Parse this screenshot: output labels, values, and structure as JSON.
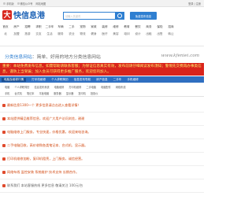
{
  "topbar": {
    "items": [
      "手机版",
      "微信公众号",
      "网站地图"
    ],
    "right": "登录 | 注册"
  },
  "logo": {
    "mark": "大",
    "name": "快信息港"
  },
  "search": {
    "placeholder": "请输入关键词"
  },
  "header": {
    "publish_label": "免费发布信息"
  },
  "nav": {
    "row1": [
      "首页",
      "房产",
      "招聘",
      "求职",
      "二手车",
      "车辆",
      "二手",
      "宠物",
      "家政",
      "装修",
      "维修",
      "教育",
      "餐饮",
      "商务",
      "保险",
      "招商"
    ],
    "row2": [
      "北",
      "加盟",
      "旅游",
      "交友",
      "生活",
      "服务",
      "农业",
      "物流",
      "健身",
      "医疗",
      "美容",
      "培训",
      "设计",
      "出租",
      "出售",
      "转让"
    ]
  },
  "slogan": {
    "prefix": "分类信息网站",
    "suffix": "：简单、好用的地方分类信息网站",
    "url": "www.kfeniei.com"
  },
  "notice": {
    "text": "重要：本站免费发布信息，如需帮助请联系客服；为保证信息真实有效，发布前请仔细阅读发布须知；警惕先交费再办事类信息，谨防上当受骗；加入会员可获得更多推广服务，欢迎您的加入。"
  },
  "tabs": [
    "电脑及维修行情",
    "打印机维修",
    "个人求职简历",
    "信息发布导航",
    "房产信息",
    "二手车",
    "手机维修"
  ],
  "subtabs": {
    "row1": [
      "电脑",
      "个人求职简历",
      "信息发布系统",
      "电脑维修",
      "打印机维修",
      "二手电脑",
      "电脑配件",
      "网络布线"
    ],
    "row2": [
      "手机",
      "台式机",
      "笔记本",
      "平板电脑",
      "服务器",
      "显示器",
      "复印机",
      "投影仪"
    ]
  },
  "list": [
    "最新信息1300一个 更多信息请点击进入查看详情！",
    "本站提供精品推荐信息，欢迎广大用户访问浏览，谢谢",
    "电脑维修上门服务，专业快速，价格优惠，欢迎来电咨询。",
    "二手电脑回收，高价收购各类笔记本、台式机、显示器。",
    "打印机维修加粉，复印机租赁，上门服务，诚信经营。",
    "网络布线 监控安装 系统维护 技术支持 长期合作。",
    "联系我们 本站客服热线 更多信息 敬请关注 100元/台"
  ]
}
